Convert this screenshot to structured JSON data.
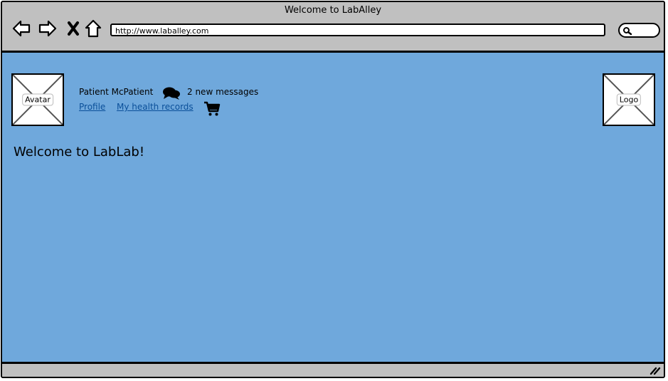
{
  "window": {
    "title": "Welcome to LabAlley"
  },
  "toolbar": {
    "url": "http://www.laballey.com",
    "icons": [
      "back-arrow-icon",
      "forward-arrow-icon",
      "close-icon",
      "home-icon",
      "search-icon"
    ]
  },
  "header": {
    "avatar_label": "Avatar",
    "user_name": "Patient McPatient",
    "messages_text": "2 new messages",
    "links": {
      "profile": "Profile",
      "health_records": "My health records"
    },
    "logo_label": "Logo"
  },
  "main": {
    "welcome": "Welcome to LabLab!"
  },
  "colors": {
    "content_background": "#6fa8dc",
    "chrome_background": "#c0c0c0",
    "link": "#0a4f99"
  }
}
